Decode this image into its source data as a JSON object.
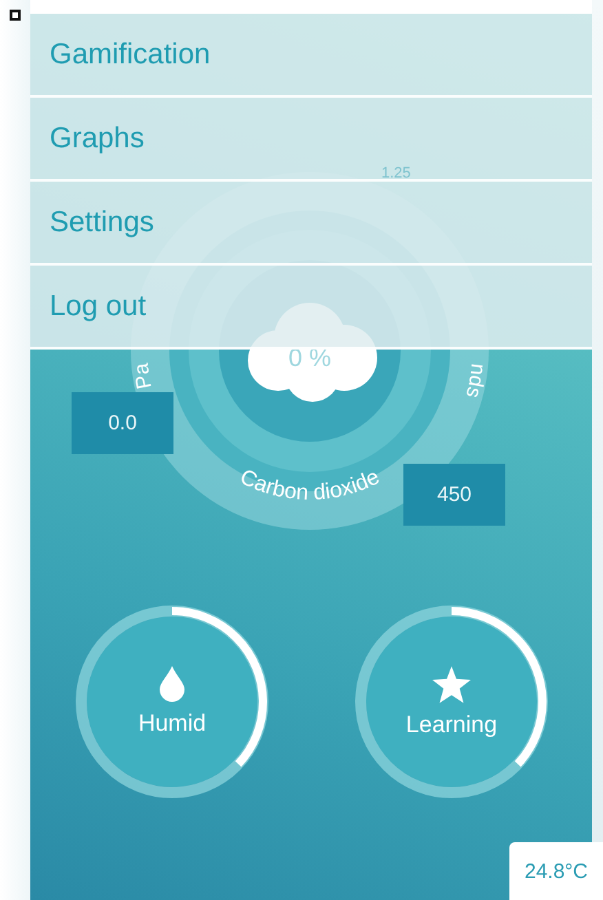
{
  "menu": {
    "items": [
      {
        "label": "Gamification"
      },
      {
        "label": "Graphs"
      },
      {
        "label": "Settings"
      },
      {
        "label": "Log out"
      }
    ]
  },
  "gauge": {
    "top_value": "1.25",
    "center_reading": "0 %",
    "left_label": "Pa",
    "right_label": "nds",
    "bottom_label": "Carbon dioxide",
    "left_value": "0.0",
    "right_value": "450"
  },
  "indicators": [
    {
      "label": "Humid",
      "kind": "drop"
    },
    {
      "label": "Learning",
      "kind": "star"
    }
  ],
  "temperature": "24.8°C"
}
